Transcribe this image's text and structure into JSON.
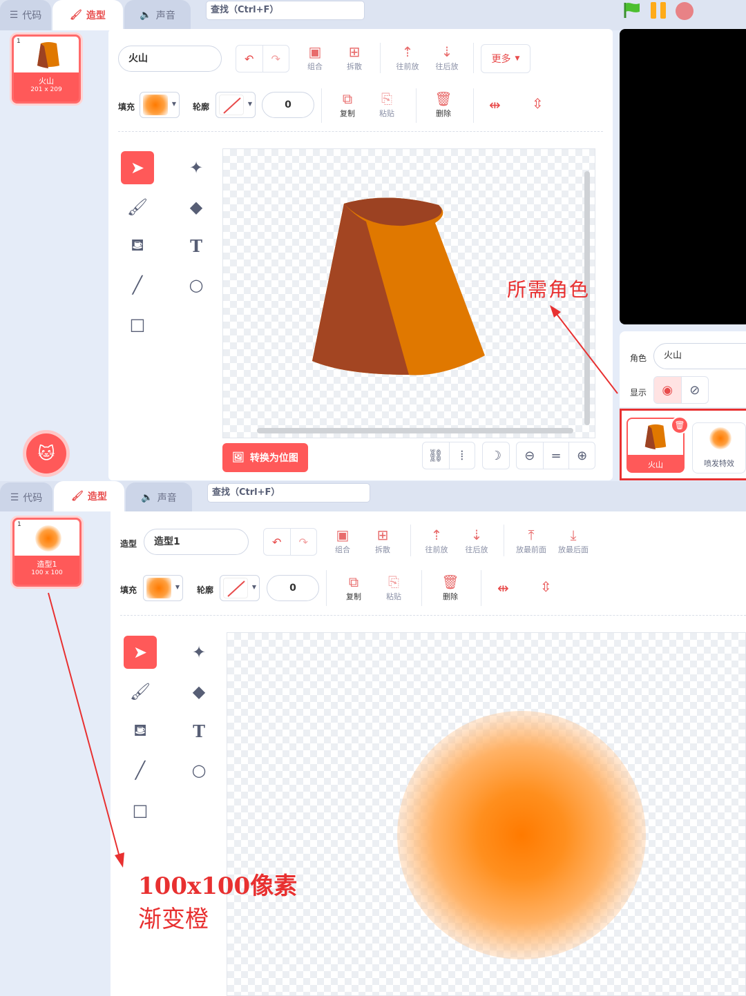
{
  "tabs": {
    "code": "代码",
    "costume": "造型",
    "sound": "声音"
  },
  "search_placeholder": "查找（Ctrl+F）",
  "top": {
    "costume": {
      "num": "1",
      "name": "火山",
      "size": "201 x 209"
    },
    "name_value": "火山",
    "toolbar": {
      "group": "组合",
      "ungroup": "拆散",
      "forward": "往前放",
      "backward": "往后放",
      "more": "更多"
    },
    "toolbar2": {
      "copy": "复制",
      "paste": "粘贴",
      "delete": "删除"
    },
    "fill_label": "填充",
    "outline_label": "轮廓",
    "outline_width": "0",
    "convert_bitmap": "转换为位图",
    "annotation": "所需角色",
    "sprite": {
      "label": "角色",
      "value": "火山",
      "show_label": "显示"
    },
    "sprites": [
      {
        "name": "火山"
      },
      {
        "name": "喷发特效"
      }
    ]
  },
  "bottom": {
    "costume": {
      "num": "1",
      "name": "造型1",
      "size": "100 x 100"
    },
    "costume_label": "造型",
    "name_value": "造型1",
    "toolbar": {
      "group": "组合",
      "ungroup": "拆散",
      "forward": "往前放",
      "backward": "往后放",
      "front": "放最前面",
      "back": "放最后面"
    },
    "toolbar2": {
      "copy": "复制",
      "paste": "粘贴",
      "delete": "删除"
    },
    "fill_label": "填充",
    "outline_label": "轮廓",
    "outline_width": "0",
    "annotation_line1": "100x100像素",
    "annotation_line2": "渐变橙"
  },
  "colors": {
    "accent": "#ff5959",
    "orange": "#ff8c1a",
    "volcano_dark": "#9c4222",
    "volcano_light": "#e07800"
  }
}
